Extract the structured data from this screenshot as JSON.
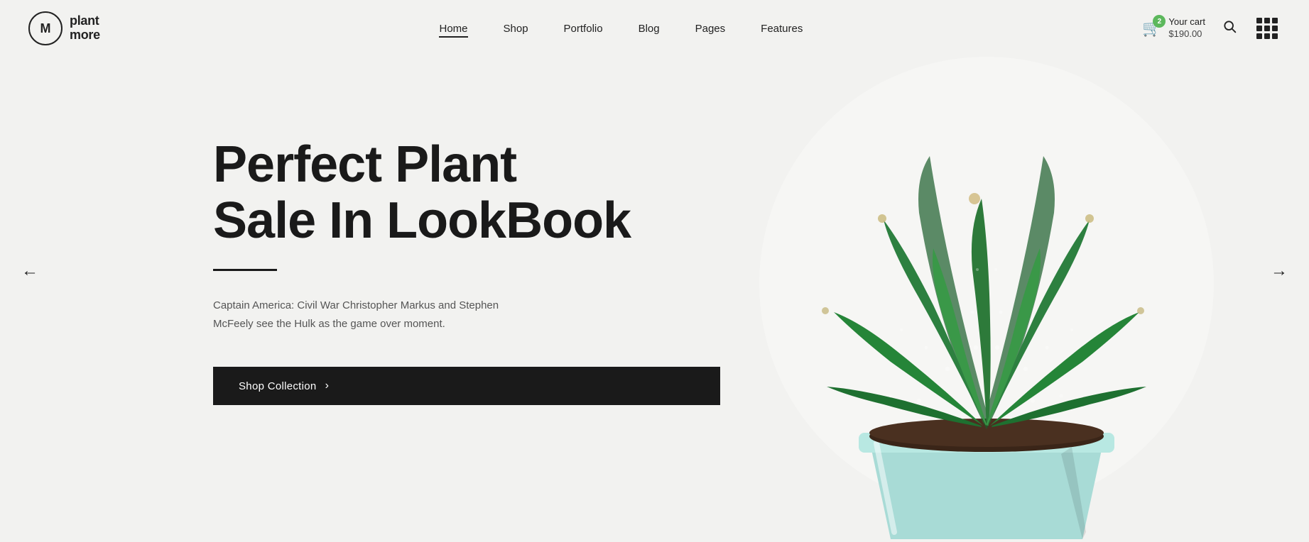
{
  "brand": {
    "initial": "M",
    "name_line1": "plant",
    "name_line2": "more"
  },
  "nav": {
    "links": [
      {
        "label": "Home",
        "active": true
      },
      {
        "label": "Shop",
        "active": false
      },
      {
        "label": "Portfolio",
        "active": false
      },
      {
        "label": "Blog",
        "active": false
      },
      {
        "label": "Pages",
        "active": false
      },
      {
        "label": "Features",
        "active": false
      }
    ]
  },
  "cart": {
    "badge_count": "2",
    "title": "Your cart",
    "amount": "$190.00"
  },
  "hero": {
    "headline_line1": "Perfect Plant",
    "headline_line2": "Sale In LookBook",
    "description": "Captain America: Civil War Christopher Markus and Stephen McFeely see the Hulk as the game over moment.",
    "cta_label": "Shop Collection"
  },
  "arrows": {
    "left": "←",
    "right": "→"
  }
}
